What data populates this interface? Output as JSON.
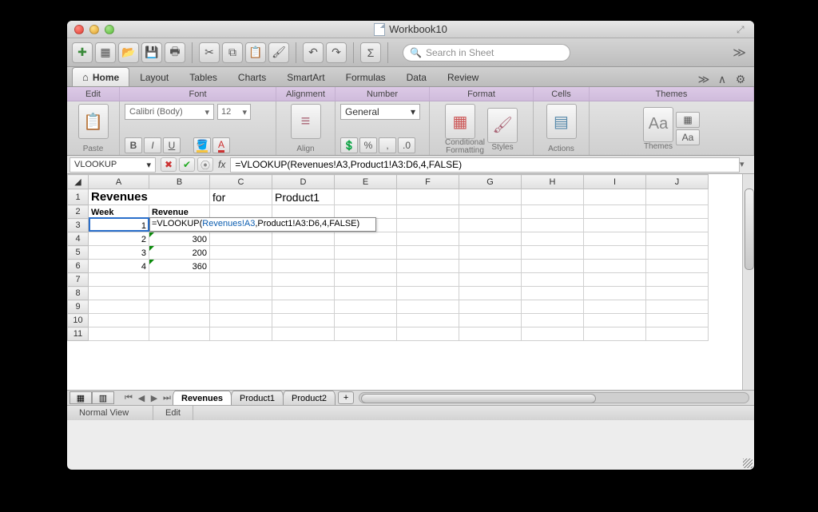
{
  "window": {
    "title": "Workbook10"
  },
  "search": {
    "placeholder": "Search in Sheet"
  },
  "ribbon": {
    "tabs": [
      "Home",
      "Layout",
      "Tables",
      "Charts",
      "SmartArt",
      "Formulas",
      "Data",
      "Review"
    ],
    "activeTabIndex": 0,
    "groups": {
      "edit": {
        "label": "Edit",
        "paste": "Paste"
      },
      "font": {
        "label": "Font",
        "name": "Calibri (Body)",
        "size": "12",
        "bold": "B",
        "italic": "I",
        "underline": "U"
      },
      "alignment": {
        "label": "Alignment",
        "align": "Align"
      },
      "number": {
        "label": "Number",
        "format": "General"
      },
      "format": {
        "label": "Format",
        "conditional": "Conditional\nFormatting",
        "styles": "Styles"
      },
      "cells": {
        "label": "Cells",
        "actions": "Actions"
      },
      "themes": {
        "label": "Themes",
        "themes": "Themes",
        "aa": "Aa"
      }
    }
  },
  "formula_bar": {
    "name_box": "VLOOKUP",
    "formula_prefix": "=VLOOKUP(",
    "formula_ref": "Revenues!A3",
    "formula_suffix": ",Product1!A3:D6,4,FALSE)",
    "formula_full": "=VLOOKUP(Revenues!A3,Product1!A3:D6,4,FALSE)"
  },
  "sheet": {
    "columns": [
      "A",
      "B",
      "C",
      "D",
      "E",
      "F",
      "G",
      "H",
      "I",
      "J"
    ],
    "rows": [
      1,
      2,
      3,
      4,
      5,
      6,
      7,
      8,
      9,
      10,
      11
    ],
    "cells": {
      "A1": "Revenues",
      "C1": "for",
      "D1": "Product1",
      "A2": "Week",
      "B2": "Revenue",
      "A3": "1",
      "A4": "2",
      "B4": "300",
      "A5": "3",
      "B5": "200",
      "A6": "4",
      "B6": "360"
    },
    "editing_cell": "B3",
    "editing_display_prefix": "=VLOOKUP(",
    "editing_display_ref": "Revenues!A3",
    "editing_display_suffix": ",Product1!A3:D6,4,FALSE)"
  },
  "sheet_tabs": {
    "tabs": [
      "Revenues",
      "Product1",
      "Product2"
    ],
    "activeIndex": 0
  },
  "status": {
    "view": "Normal View",
    "mode": "Edit"
  }
}
